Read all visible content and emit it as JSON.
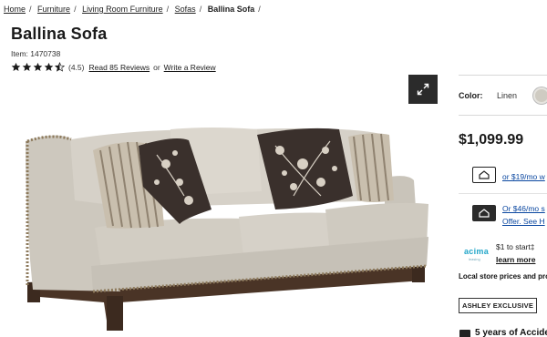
{
  "breadcrumb": {
    "items": [
      "Home",
      "Furniture",
      "Living Room Furniture",
      "Sofas"
    ],
    "current": "Ballina Sofa"
  },
  "product": {
    "title": "Ballina Sofa",
    "item_number": "Item: 1470738",
    "rating": 4.5,
    "rating_text": "(4.5)",
    "reviews_link": "Read 85 Reviews",
    "or_text": "or",
    "write_review": "Write a Review"
  },
  "options": {
    "color_label": "Color:",
    "color_value": "Linen",
    "swatch_color": "#cfcbc2"
  },
  "pricing": {
    "price": "$1,099.99",
    "financing_1": "or $19/mo w",
    "financing_2a": "Or $46/mo s",
    "financing_2b": "Offer. See H",
    "acima_logo": "acima",
    "acima_sub": "leasing",
    "acima_line": "$1 to start‡",
    "acima_link": "learn more",
    "local_note": "Local store prices and pro"
  },
  "badges": {
    "exclusive": "ASHLEY EXCLUSIVE",
    "warranty": "5 years of Acciden"
  },
  "icons": {
    "expand": "expand-icon",
    "star": "star-icon",
    "financing_card": "card-icon"
  },
  "colors": {
    "link_blue": "#0a47a0",
    "acima_teal": "#22a6c9",
    "dark_button": "#2b2b2b"
  }
}
